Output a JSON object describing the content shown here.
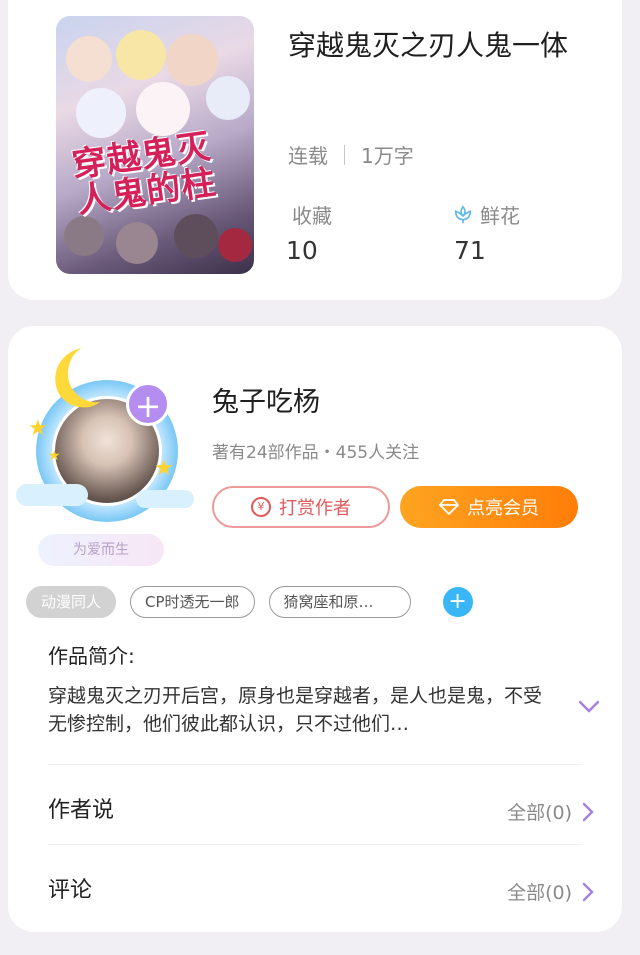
{
  "book": {
    "cover_title_art": "穿越鬼灭 人鬼的柱",
    "title": "穿越鬼灭之刃人鬼一体",
    "status": "连载",
    "word_count": "1万字",
    "favorites_label": "收藏",
    "favorites_value": "10",
    "flowers_label": "鲜花",
    "flowers_value": "71"
  },
  "author": {
    "name": "兔子吃杨",
    "stats": "著有24部作品・455人关注",
    "love_badge": "为爱而生",
    "tip_button": "打赏作者",
    "vip_button": "点亮会员"
  },
  "tags": [
    "动漫同人",
    "CP时透无一郎",
    "猗窝座和原…"
  ],
  "intro": {
    "label": "作品简介:",
    "text": "穿越鬼灭之刃开后宫，原身也是穿越者，是人也是鬼，不受无惨控制，他们彼此都认识，只不过他们…"
  },
  "rows": {
    "author_says": "作者说",
    "author_says_count": "全部(0)",
    "comments": "评论",
    "comments_count": "全部(0)"
  },
  "colors": {
    "accent_orange": "#ff8c12",
    "tip_red": "#e0595b",
    "tag_plus_blue": "#38b6f5",
    "chevron_purple": "#a77fe0"
  }
}
